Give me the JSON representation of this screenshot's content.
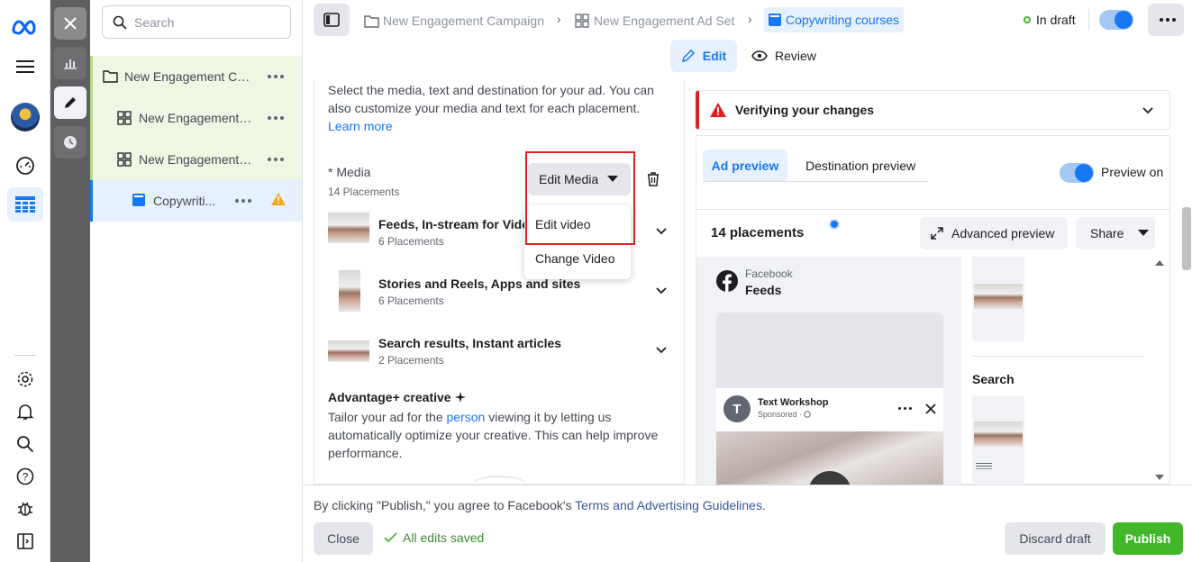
{
  "colors": {
    "accent": "#1877f2",
    "publish": "#42b72a",
    "warning": "#e02020",
    "draft_dot": "#42b72a"
  },
  "nav": {
    "search_placeholder": "Search",
    "tree": [
      {
        "label": "New Engagement Ca...",
        "icon": "folder-icon"
      },
      {
        "label": "New Engagement ...",
        "icon": "grid-icon"
      },
      {
        "label": "New Engagement ...",
        "icon": "grid-icon"
      },
      {
        "label": "Copywriti...",
        "icon": "ad-icon"
      }
    ]
  },
  "header": {
    "breadcrumb": [
      "New Engagement Campaign",
      "New Engagement Ad Set",
      "Copywriting courses"
    ],
    "status": "In draft",
    "tabs": {
      "edit": "Edit",
      "review": "Review"
    }
  },
  "editor": {
    "intro": "Select the media, text and destination for your ad. You can also customize your media and text for each placement.",
    "learn_more": "Learn more",
    "media_label": "* Media",
    "media_sub": "14 Placements",
    "edit_media_btn": "Edit Media",
    "dropdown": [
      "Edit video",
      "Change Video"
    ],
    "rows": [
      {
        "title": "Feeds, In-stream for Videos",
        "sub": "6 Placements"
      },
      {
        "title": "Stories and Reels, Apps and sites",
        "sub": "6 Placements"
      },
      {
        "title": "Search results, Instant articles",
        "sub": "2 Placements"
      }
    ],
    "advantage_title": "Advantage+ creative",
    "advantage_pre": "Tailor your ad for the ",
    "advantage_link": "person",
    "advantage_post": " viewing it by letting us automatically optimize your creative. This can help improve performance."
  },
  "preview": {
    "verify": "Verifying your changes",
    "tab_ad": "Ad preview",
    "tab_dest": "Destination preview",
    "preview_on": "Preview on",
    "placements": "14 placements",
    "advanced": "Advanced preview",
    "share": "Share",
    "fb_label": "Facebook",
    "fb_feeds": "Feeds",
    "page_name": "Text Workshop",
    "sponsored": "Sponsored · ",
    "avatar_letter": "T",
    "search_label": "Search"
  },
  "footer": {
    "notice_pre": "By clicking \"Publish,\" you agree to Facebook's ",
    "notice_link": "Terms and Advertising Guidelines",
    "notice_post": ".",
    "close": "Close",
    "saved": "All edits saved",
    "discard": "Discard draft",
    "publish": "Publish"
  }
}
